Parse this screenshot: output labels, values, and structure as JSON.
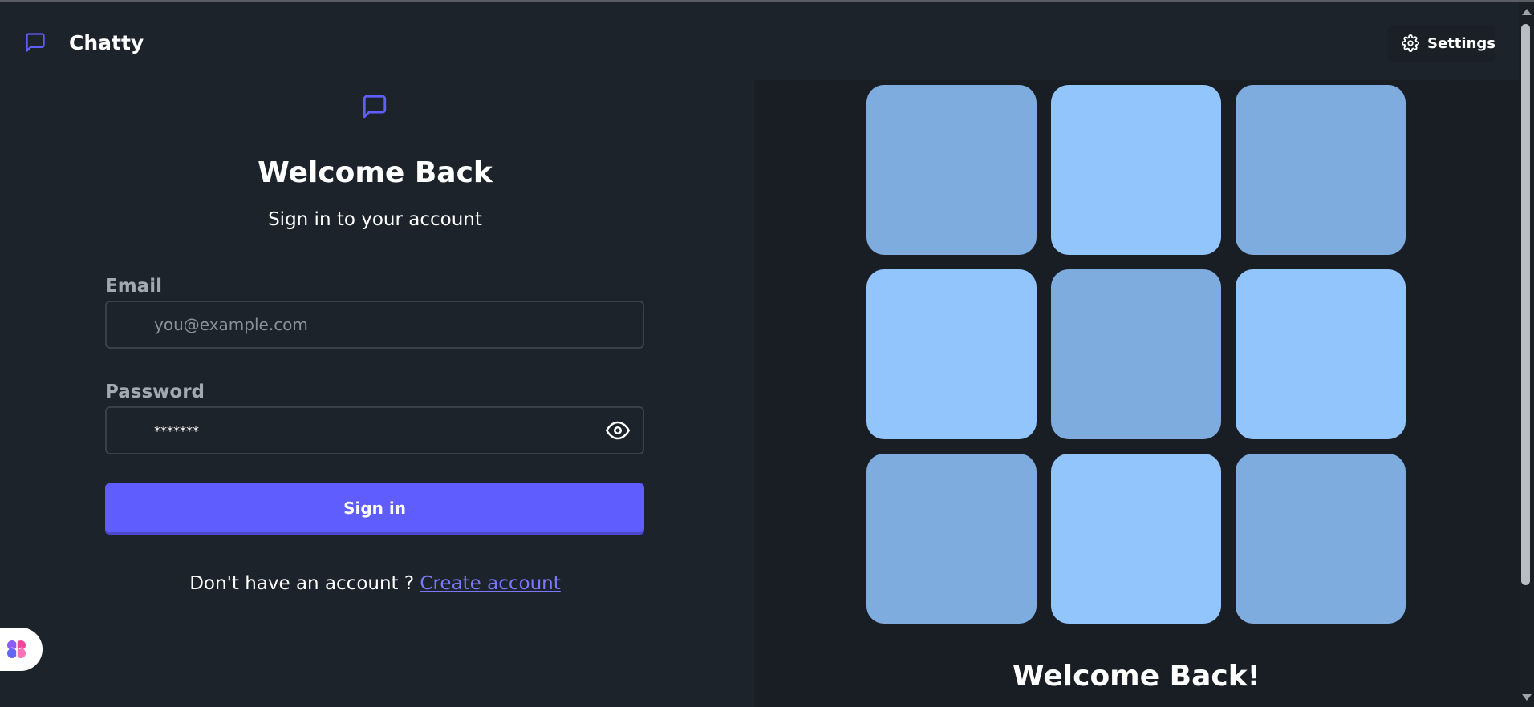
{
  "header": {
    "app_title": "Chatty",
    "settings_label": "Settings"
  },
  "login_form": {
    "title": "Welcome Back",
    "subtitle": "Sign in to your account",
    "email_label": "Email",
    "email_placeholder": "you@example.com",
    "email_value": "",
    "password_label": "Password",
    "password_value": "*******",
    "submit_label": "Sign in",
    "signup_prompt": "Don't have an account ?",
    "signup_link": "Create account"
  },
  "promo": {
    "title": "Welcome Back!",
    "tiles": [
      "dark",
      "light",
      "dark",
      "light",
      "dark",
      "light",
      "dark",
      "light",
      "dark"
    ]
  },
  "colors": {
    "accent": "#605dff",
    "tile_dark": "#7facde",
    "tile_light": "#93c5fd"
  },
  "icons": {
    "logo": "message-square-icon",
    "settings": "gear-icon",
    "password_toggle": "eye-icon",
    "extension": "brain-icon"
  }
}
